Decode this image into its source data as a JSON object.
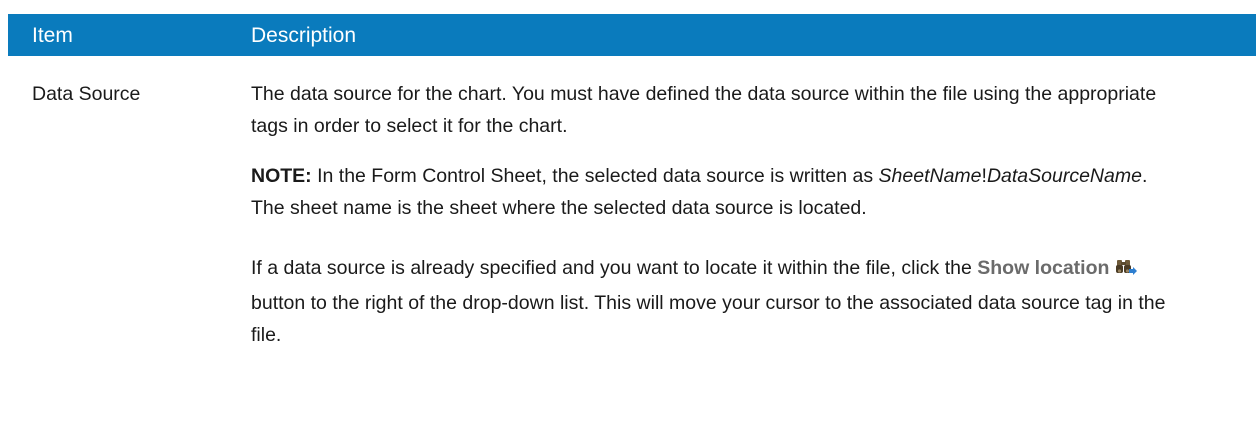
{
  "table": {
    "header": {
      "item": "Item",
      "description": "Description"
    },
    "row": {
      "item": "Data Source",
      "para1": "The data source for the chart. You must have defined the data source within the file using the appropriate tags in order to select it for the chart.",
      "note_label": "NOTE:",
      "note_text_1": " In the Form Control Sheet, the selected data source is written as ",
      "sheet_name": "SheetName",
      "exclam": "!",
      "data_source_name": "DataSourceName",
      "note_text_2": ". The sheet name is the sheet where the selected data source is located.",
      "para3_a": "If a data source is already specified and you want to locate it within the file, click the ",
      "show_location": "Show location",
      "para3_b": " button to the right of the drop-down list. This will move your cursor to the associated data source tag in the file."
    }
  },
  "colors": {
    "header_bg": "#0a7bbd",
    "header_text": "#ffffff",
    "show_location_text": "#6b6b6b",
    "icon_blue": "#2e7fd0"
  },
  "icons": {
    "show_location_icon": "binoculars-icon"
  }
}
